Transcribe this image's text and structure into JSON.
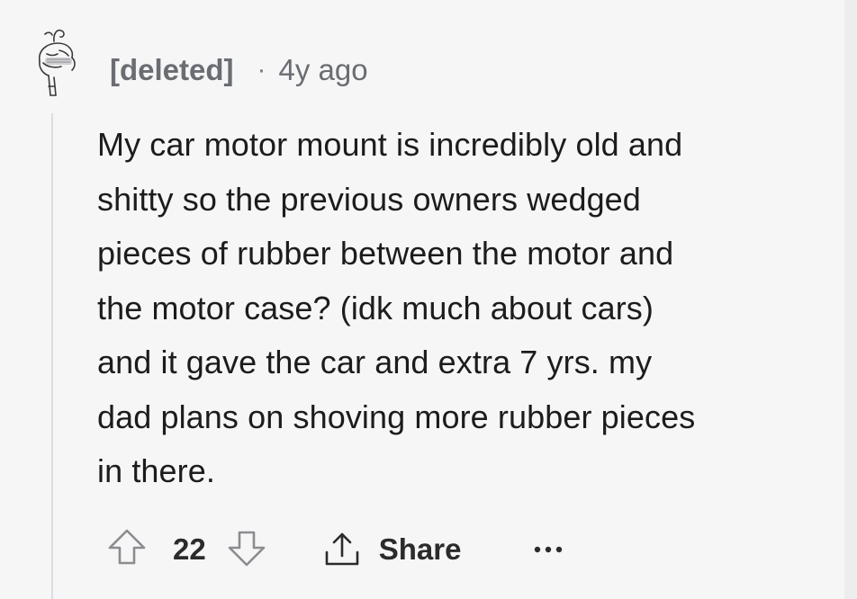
{
  "comment": {
    "author": "[deleted]",
    "separator": "·",
    "age": "4y ago",
    "body_lines": [
      "My car motor mount is incredibly old and",
      "shitty so the previous owners wedged",
      "pieces of rubber between the motor and",
      "the motor case? (idk much about cars)",
      "and it gave the car and extra 7 yrs. my",
      "dad plans on shoving more rubber pieces",
      "in there."
    ]
  },
  "actions": {
    "vote_count": "22",
    "share_label": "Share",
    "upvote_icon": "arrow-up-outline-icon",
    "downvote_icon": "arrow-down-outline-icon",
    "share_icon": "share-upload-icon",
    "more_icon": "more-horizontal-icon"
  },
  "colors": {
    "background": "#f6f6f7",
    "meta_text": "#6a6d72",
    "body_text": "#1c1c1c",
    "icon": "#8a8c90"
  }
}
